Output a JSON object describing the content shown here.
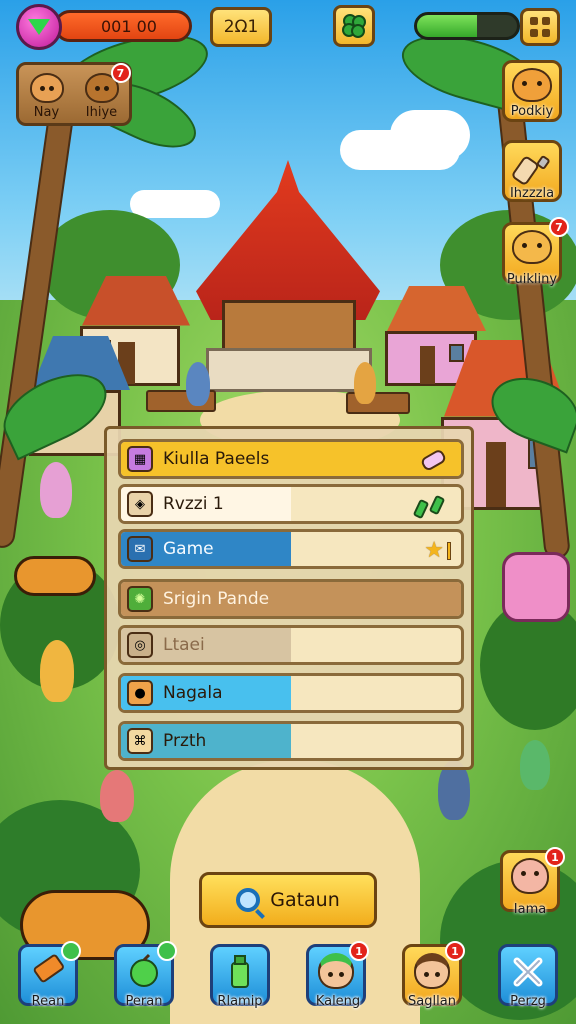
{
  "hud": {
    "coins": "001 00",
    "level": "2Ω1",
    "energy_fraction": 0.6,
    "friends": [
      {
        "name": "Nay",
        "badge": ""
      },
      {
        "name": "Ihiye",
        "badge": "7"
      }
    ]
  },
  "side_buttons": [
    {
      "label": "Podkiy",
      "badge": ""
    },
    {
      "label": "Ihzzzla",
      "badge": ""
    },
    {
      "label": "Puikliny",
      "badge": "7"
    }
  ],
  "list": {
    "rows": [
      {
        "label": "Kiulla Paeels",
        "icon": "gift-box-icon",
        "fill": 1.0,
        "color": "#f6c22a"
      },
      {
        "label": "Rvzzi 1",
        "icon": "target-icon",
        "fill": 0.5,
        "color": "#fff6e4"
      },
      {
        "label": "Game",
        "icon": "mail-icon",
        "fill": 0.5,
        "color": "#2f86c6"
      },
      {
        "label": "Srigin Pande",
        "icon": "sparkle-icon",
        "fill": 1.0,
        "color": "#c4925a"
      },
      {
        "label": "Ltaei",
        "icon": "spiral-icon",
        "fill": 0.5,
        "color": "#d7c4a2"
      },
      {
        "label": "Nagala",
        "icon": "fruit-basket-icon",
        "fill": 0.5,
        "color": "#48c0ee"
      },
      {
        "label": "Przth",
        "icon": "map-icon",
        "fill": 0.5,
        "color": "#4eb3cc"
      }
    ]
  },
  "search": {
    "label": "Gataun"
  },
  "profile": {
    "label": "Iama",
    "badge": "1"
  },
  "bottom_nav": [
    {
      "label": "Rean",
      "badge": "",
      "icon": "tag-icon"
    },
    {
      "label": "Peran",
      "badge": "",
      "icon": "fruit-icon"
    },
    {
      "label": "Rlamip",
      "badge": "",
      "icon": "bottle-icon"
    },
    {
      "label": "Kaleng",
      "badge": "1",
      "icon": "avatar-icon"
    },
    {
      "label": "Sagllan",
      "badge": "1",
      "icon": "avatar-icon"
    },
    {
      "label": "Perzg",
      "badge": "",
      "icon": "close-icon"
    }
  ]
}
